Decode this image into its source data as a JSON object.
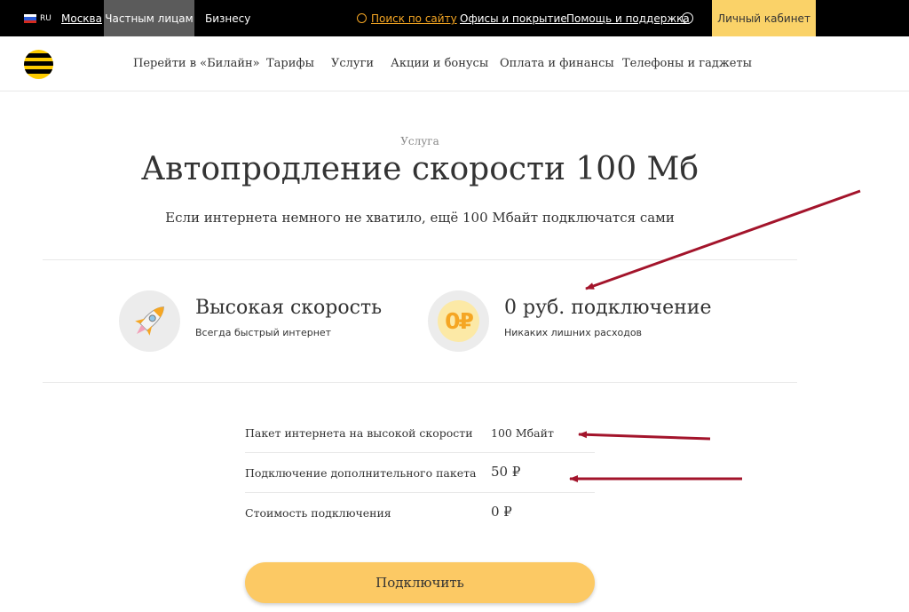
{
  "topbar": {
    "lang": "RU",
    "city": "Москва",
    "tabs": [
      "Частным лицам",
      "Бизнесу"
    ],
    "search": "Поиск по сайту",
    "offices": "Офисы и покрытие",
    "help": "Помощь и поддержка",
    "cabinet": "Личный кабинет"
  },
  "nav": {
    "items": [
      "Перейти в «Билайн»",
      "Тарифы",
      "Услуги",
      "Акции и бонусы",
      "Оплата и финансы",
      "Телефоны и гаджеты"
    ]
  },
  "hero": {
    "eyebrow": "Услуга",
    "title": "Автопродление скорости 100 Мб",
    "subtitle": "Если интернета немного не хватило, ещё 100 Мбайт подключатся сами"
  },
  "features": [
    {
      "title": "Высокая скорость",
      "sub": "Всегда быстрый интернет",
      "icon": "rocket-icon"
    },
    {
      "title": "0 руб. подключение",
      "sub": "Никаких лишних расходов",
      "icon": "zero-ruble-icon",
      "badge": "0₽"
    }
  ],
  "details": [
    {
      "label": "Пакет интернета на высокой скорости",
      "value": "100 Мбайт"
    },
    {
      "label": "Подключение дополнительного пакета",
      "value": "50 ₽"
    },
    {
      "label": "Стоимость подключения",
      "value": "0 ₽"
    }
  ],
  "cta": "Подключить",
  "colors": {
    "accent": "#fecc00",
    "button": "#fcc964",
    "search": "#f5a623",
    "annotation_arrow": "#a3142b"
  }
}
